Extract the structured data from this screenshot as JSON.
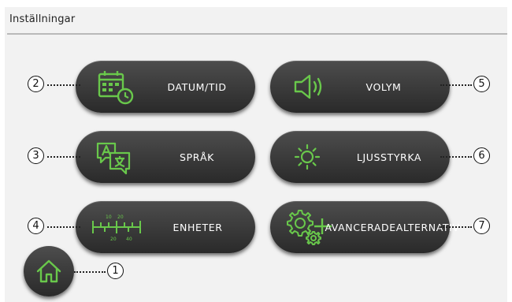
{
  "header": {
    "title": "Inställningar"
  },
  "buttons": {
    "datum_tid": "DATUM/TID",
    "volym": "VOLYM",
    "sprak": "SPRÅK",
    "ljusstyrka": "LJUSSTYRKA",
    "enheter": "ENHETER",
    "avancerade_line1": "AVANCERADE",
    "avancerade_line2": "ALTERNATIV"
  },
  "units_icon": {
    "top_ticks": [
      "10",
      "20"
    ],
    "bottom_ticks": [
      "20",
      "40"
    ]
  },
  "callouts": [
    "1",
    "2",
    "3",
    "4",
    "5",
    "6",
    "7"
  ],
  "icons": {
    "datum_tid": "calendar-clock-icon",
    "volym": "speaker-icon",
    "sprak": "translate-icon",
    "ljusstyrka": "sun-icon",
    "enheter": "ruler-icon",
    "avancerade": "gears-plus-icon",
    "home": "home-icon"
  },
  "colors": {
    "accent": "#69c84b",
    "button": "#3a3a3a",
    "background": "#f2f2f2"
  }
}
